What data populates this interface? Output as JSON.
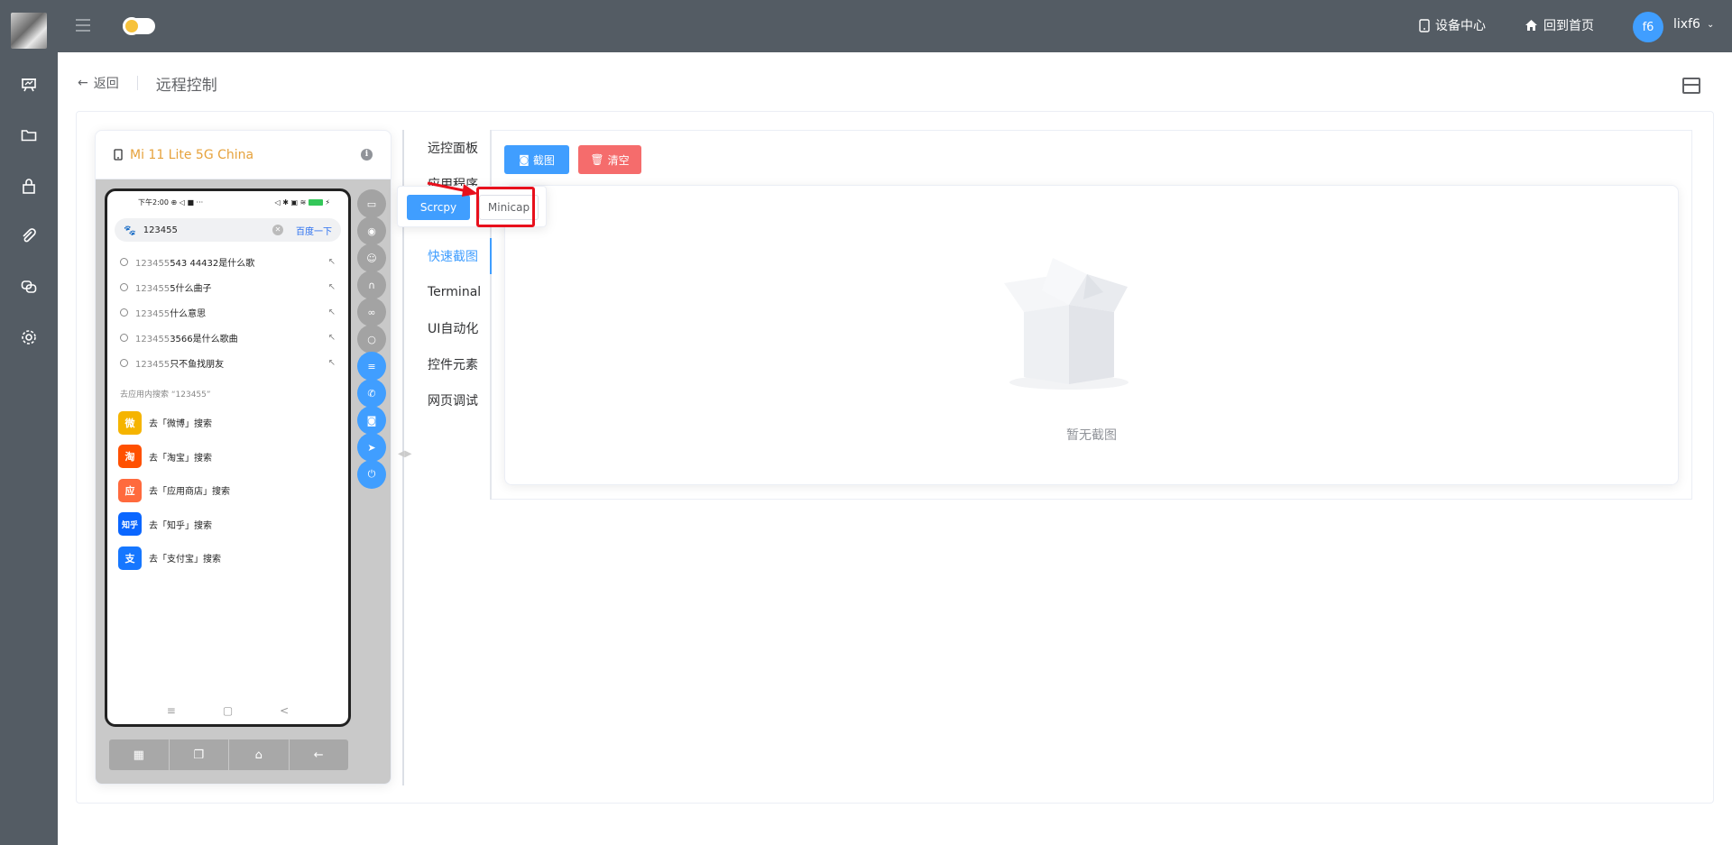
{
  "header": {
    "device_center": "设备中心",
    "home": "回到首页",
    "avatar_initials": "f6",
    "username": "lixf6"
  },
  "sidebar_icons": [
    "presentation-icon",
    "folder-icon",
    "lock-icon",
    "paperclip-icon",
    "copy-icon",
    "gear-icon"
  ],
  "page": {
    "back": "返回",
    "title": "远程控制"
  },
  "device": {
    "name": "Mi 11 Lite 5G China"
  },
  "phone": {
    "time": "下午2:00",
    "search_value": "123455",
    "search_button": "百度一下",
    "suggestions": [
      {
        "prefix": "123455",
        "rest": "543 44432是什么歌"
      },
      {
        "prefix": "123455",
        "rest": "5什么曲子"
      },
      {
        "prefix": "123455",
        "rest": "什么意思"
      },
      {
        "prefix": "123455",
        "rest": "3566是什么歌曲"
      },
      {
        "prefix": "123455",
        "rest": "只不鱼找朋友"
      }
    ],
    "section_title": "去应用内搜索 “123455”",
    "apps": [
      {
        "label": "去「微博」搜索",
        "icon_text": "微",
        "color": "#f5b400"
      },
      {
        "label": "去「淘宝」搜索",
        "icon_text": "淘",
        "color": "#ff5000"
      },
      {
        "label": "去「应用商店」搜索",
        "icon_text": "应",
        "color": "#ff6a3d"
      },
      {
        "label": "去「知乎」搜索",
        "icon_text": "知乎",
        "color": "#0a66ff"
      },
      {
        "label": "去「支付宝」搜索",
        "icon_text": "支",
        "color": "#1677ff"
      }
    ]
  },
  "popover": {
    "scrcpy": "Scrcpy",
    "minicap": "Minicap"
  },
  "tabs": {
    "remote_panel": "远控面板",
    "app_manage": "应用程序",
    "quick_shot": "快速截图",
    "terminal": "Terminal",
    "ui_auto": "UI自动化",
    "widgets": "控件元素",
    "web_debug": "网页调试"
  },
  "panel": {
    "screenshot_btn": "截图",
    "clear_btn": "清空",
    "empty_text": "暂无截图"
  }
}
